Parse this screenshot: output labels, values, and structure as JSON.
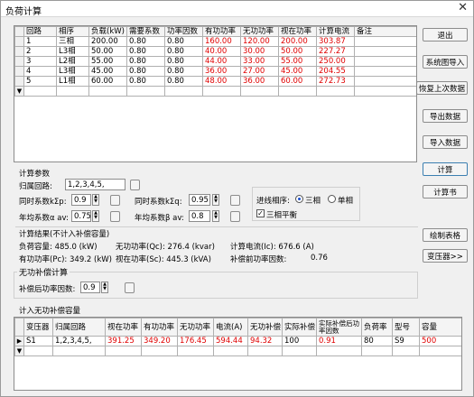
{
  "window": {
    "title": "负荷计算",
    "close": "✕"
  },
  "load_table": {
    "headers": [
      "回路",
      "相序",
      "负载(kW)",
      "需要系数",
      "功率因数",
      "有功功率",
      "无功功率",
      "视在功率",
      "计算电流",
      "备注"
    ],
    "rows": [
      [
        "1",
        "三相",
        "200.00",
        "0.80",
        "0.80",
        "160.00",
        "120.00",
        "200.00",
        "303.87",
        ""
      ],
      [
        "2",
        "L3相",
        "50.00",
        "0.80",
        "0.80",
        "40.00",
        "30.00",
        "50.00",
        "227.27",
        ""
      ],
      [
        "3",
        "L2相",
        "55.00",
        "0.80",
        "0.80",
        "44.00",
        "33.00",
        "55.00",
        "250.00",
        ""
      ],
      [
        "4",
        "L3相",
        "45.00",
        "0.80",
        "0.80",
        "36.00",
        "27.00",
        "45.00",
        "204.55",
        ""
      ],
      [
        "5",
        "L1相",
        "60.00",
        "0.80",
        "0.80",
        "48.00",
        "36.00",
        "60.00",
        "272.73",
        ""
      ]
    ],
    "new_row_marker": "▼"
  },
  "buttons": {
    "exit": "退出",
    "import_system": "系统图导入",
    "restore_last": "恢复上次数据",
    "export_data": "导出数据",
    "import_data": "导入数据",
    "calculate": "计算",
    "calc_book": "计算书",
    "draw_table": "绘制表格",
    "transformer": "变压器>>"
  },
  "params": {
    "group_title": "计算参数",
    "circuit_label": "归属回路:",
    "circuit_value": "1,2,3,4,5,",
    "kp_label": "同时系数kΣp:",
    "kp_value": "0.9",
    "kq_label": "同时系数kΣq:",
    "kq_value": "0.95",
    "alpha_label": "年均系数α av:",
    "alpha_value": "0.75",
    "beta_label": "年均系数β av:",
    "beta_value": "0.8",
    "phase_label": "进线相序:",
    "three_phase": "三相",
    "single_phase": "单相",
    "balance": "三相平衡",
    "check": "✓"
  },
  "results": {
    "title": "计算结果(不计入补偿容量)",
    "load_capacity": "负荷容量:     485.0 (kW)",
    "reactive": "无功功率(Qc): 276.4 (kvar)",
    "current": "计算电流(Ic): 676.6 (A)",
    "active": "有功功率(Pc): 349.2 (kW)",
    "apparent": "视在功率(Sc): 445.3 (kVA)",
    "pf_before_label": "补偿前功率因数:",
    "pf_before_value": "0.76"
  },
  "compensation": {
    "title": "无功补偿计算",
    "pf_after_label": "补偿后功率因数:",
    "pf_after_value": "0.9"
  },
  "comp_table": {
    "title": "计入无功补偿容量",
    "headers": [
      "变压器",
      "归属回路",
      "视在功率",
      "有功功率",
      "无功功率",
      "电流(A)",
      "无功补偿",
      "实际补偿",
      "实际补偿后功率因数",
      "负荷率",
      "型号",
      "容量"
    ],
    "row": [
      "S1",
      "1,2,3,4,5,",
      "391.25",
      "349.20",
      "176.45",
      "594.44",
      "94.32",
      "100",
      "0.91",
      "80",
      "S9",
      "500"
    ],
    "row_marker": "▶",
    "new_row_marker": "▼"
  }
}
